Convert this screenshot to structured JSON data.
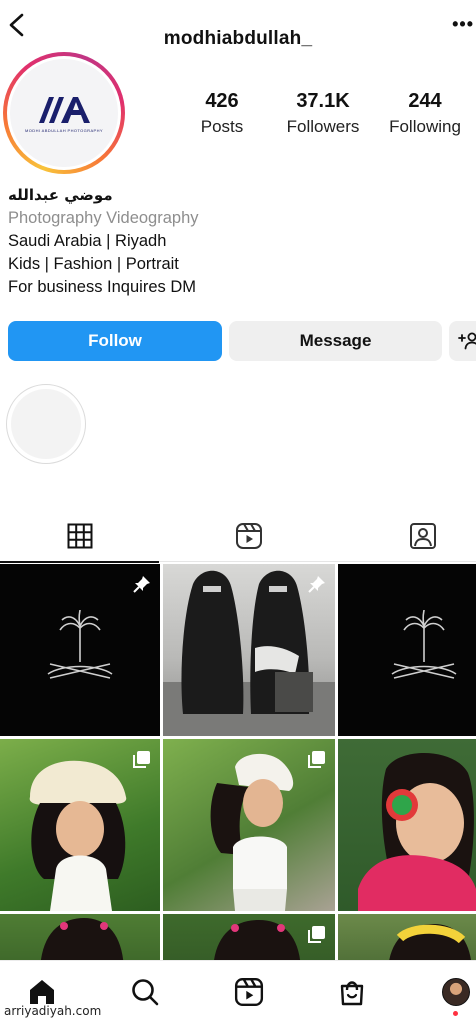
{
  "header": {
    "username": "modhiabdullah_",
    "more_icon": "more-dots-icon",
    "back_icon": "chevron-left-icon"
  },
  "profile": {
    "logo_text": "MODHI ABDULLAH PHOTOGRAPHY",
    "stats": [
      {
        "value": "426",
        "label": "Posts"
      },
      {
        "value": "37.1K",
        "label": "Followers"
      },
      {
        "value": "244",
        "label": "Following"
      }
    ]
  },
  "bio": {
    "name": "موضي عبدالله",
    "category": "Photography Videography",
    "lines": [
      "Saudi Arabia | Riyadh",
      "Kids | Fashion | Portrait",
      "For business Inquires DM"
    ]
  },
  "actions": {
    "follow": "Follow",
    "message": "Message",
    "suggest_icon": "add-person-icon"
  },
  "tabs": [
    {
      "name": "posts-grid",
      "icon": "grid-icon",
      "active": true
    },
    {
      "name": "reels",
      "icon": "reels-icon",
      "active": false
    },
    {
      "name": "tagged",
      "icon": "tagged-person-icon",
      "active": false
    }
  ],
  "colors": {
    "accent": "#2196f3",
    "button_gray": "#efefef",
    "notification": "#ff3040"
  },
  "bottom_nav": [
    "home-icon",
    "search-icon",
    "reels-icon",
    "shop-icon",
    "profile-avatar"
  ],
  "watermark": "arriyadiyah.com"
}
